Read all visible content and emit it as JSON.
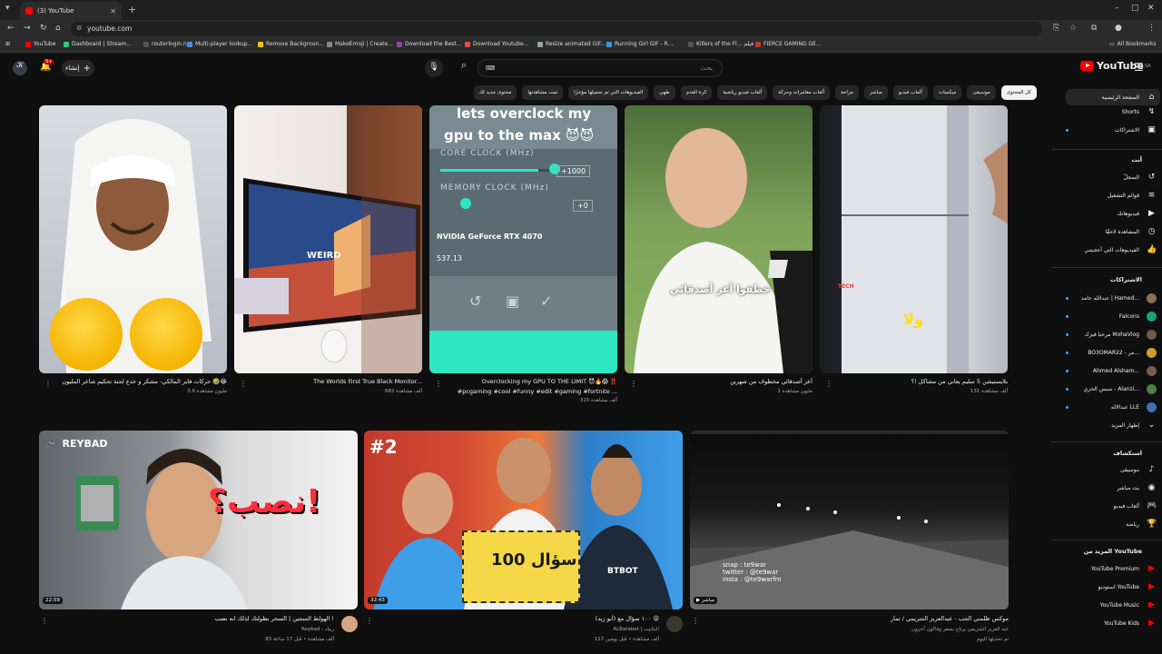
{
  "browser": {
    "tab_count": "(3)",
    "tab_title": "(3) YouTube",
    "url": "youtube.com",
    "bookmarks": [
      {
        "label": "YouTube",
        "color": "#ff0000"
      },
      {
        "label": "Dashboard | Stream...",
        "color": "#2ecc71"
      },
      {
        "label": "routerlogin.net",
        "color": "#555555"
      },
      {
        "label": "Multi-player lookup...",
        "color": "#4a90e2"
      },
      {
        "label": "Remove Backgroun...",
        "color": "#f1c40f"
      },
      {
        "label": "MakeEmoji | Create...",
        "color": "#888888"
      },
      {
        "label": "Download the Best...",
        "color": "#8e44ad"
      },
      {
        "label": "Download Youtube...",
        "color": "#e74c3c"
      },
      {
        "label": "Resize animated GIF...",
        "color": "#95a5a6"
      },
      {
        "label": "Running Girl GIF - R...",
        "color": "#3498db"
      },
      {
        "label": "Killers of the Fl... فيلم",
        "color": "#555555"
      },
      {
        "label": "FIERCE GAMING GE...",
        "color": "#c0392b"
      }
    ],
    "all_bookmarks": "All Bookmarks"
  },
  "masthead": {
    "logo_text": "YouTube",
    "logo_region": "SA",
    "search_placeholder": "بحث",
    "search_kbd": "⌨",
    "create_label": "إنشاء",
    "notif_count": "9+"
  },
  "chips": [
    {
      "label": "كل المحتوى",
      "active": true
    },
    {
      "label": "موسيقى",
      "active": false
    },
    {
      "label": "ميكسات",
      "active": false
    },
    {
      "label": "ألعاب فيديو",
      "active": false
    },
    {
      "label": "مباشر",
      "active": false
    },
    {
      "label": "مزاحة",
      "active": false
    },
    {
      "label": "ألعاب مغامرات وحركة",
      "active": false
    },
    {
      "label": "ألعاب فيديو رياضية",
      "active": false
    },
    {
      "label": "كرة القدم",
      "active": false
    },
    {
      "label": "طهي",
      "active": false
    },
    {
      "label": "الفيديوهات التي تم تحميلها مؤخرًا",
      "active": false
    },
    {
      "label": "تمت مشاهدتها",
      "active": false
    },
    {
      "label": "محتوى جديد لك",
      "active": false
    }
  ],
  "sidebar": {
    "main": [
      {
        "label": "الصفحة الرئيسية",
        "icon": "home-icon",
        "glyph": "⌂"
      },
      {
        "label": "Shorts",
        "icon": "shorts-icon",
        "glyph": "↯"
      },
      {
        "label": "الاشتراكات",
        "icon": "subscriptions-icon",
        "glyph": "▣"
      }
    ],
    "you_header": "أنت",
    "you": [
      {
        "label": "السجلّ",
        "icon": "history-icon",
        "glyph": "↺"
      },
      {
        "label": "قوائم التشغيل",
        "icon": "playlist-icon",
        "glyph": "≡"
      },
      {
        "label": "فيديوهاتك",
        "icon": "your-videos-icon",
        "glyph": "▶"
      },
      {
        "label": "المشاهدة لاحقًا",
        "icon": "watch-later-icon",
        "glyph": "◷"
      },
      {
        "label": "الفيديوهات التي أعجبتني",
        "icon": "liked-icon",
        "glyph": "👍"
      }
    ],
    "subs_header": "الاشتراكات",
    "subs": [
      {
        "label": "عبدالله حامد | Hamed...",
        "color": "#8a6f55"
      },
      {
        "label": "Falcons",
        "color": "#1aa37a"
      },
      {
        "label": "مرحبا فيزك MohaVlog",
        "color": "#6c5a48"
      },
      {
        "label": "BO3OMAR22 - مر...",
        "color": "#c9a227"
      },
      {
        "label": "Ahmed Alsham...",
        "color": "#7a5c4a"
      },
      {
        "label": "سبس الخزي - Alanzi...",
        "color": "#4f7d45"
      },
      {
        "label": "عبدالاله LLE",
        "color": "#3f6fb0"
      }
    ],
    "show_more": "إظهار المزيد",
    "explore_header": "استكشاف",
    "explore": [
      {
        "label": "موسيقى",
        "icon": "music-icon",
        "glyph": "♪"
      },
      {
        "label": "بث مباشر",
        "icon": "live-icon",
        "glyph": "◉"
      },
      {
        "label": "ألعاب فيديو",
        "icon": "gaming-icon",
        "glyph": "🎮"
      },
      {
        "label": "رياضة",
        "icon": "sports-icon",
        "glyph": "🏆"
      }
    ],
    "more_header": "المزيد من YouTube",
    "more": [
      {
        "label": "YouTube Premium"
      },
      {
        "label": "استوديو YouTube"
      },
      {
        "label": "YouTube Music"
      },
      {
        "label": "YouTube Kids"
      }
    ]
  },
  "row1": [
    {
      "title": "حركات فايز المالكي- مشكر و خدع لجنة تحكيم شاعر المليون 🤣😂",
      "views": "3.6 مليون مشاهدة"
    },
    {
      "title": "The Worlds First True Black Monitor...",
      "views": "682 ألف مشاهدة",
      "thumb_text": "WEIRD"
    },
    {
      "title": "Overclocking my GPU TO THE LIMIT 😈🔥😱 ‼️",
      "title2": "#pcgaming #cool #funny #edit #gaming #fortnite ...",
      "views": "315 ألف مشاهدة",
      "thumb_line1": "lets overclock my",
      "thumb_line2": "gpu to the max 😈😈",
      "core_clock": "CORE CLOCK (MHz)",
      "core_value": "+1000",
      "mem_clock": "MEMORY CLOCK (MHz)",
      "mem_value": "+0",
      "gpu_name": "NVIDIA GeForce RTX 4070",
      "gpu_reading": "537.13"
    },
    {
      "title": "أعز أصدقائي مخطوف من شهرين",
      "views": "1 مليون مشاهدة",
      "caption": "خطفوا أعز أصدقائي"
    },
    {
      "title": "بلايستيشن 5 سليم يعاني من مشاكل !؟",
      "views": "131 ألف مشاهدة",
      "caption": "ولا"
    }
  ],
  "row2": [
    {
      "title": "الهولط السجين | السحر بطولتك لذلك انه نصب !",
      "channel": "Reybad - ريباد",
      "views": "83 ألف مشاهدة • قبل 17 ساعة",
      "duration": "22:59",
      "brand": "REYBAD",
      "thumb_text": "نصب؟!"
    },
    {
      "title": "١٠٠ سؤال مع (أبو زيد) 😜",
      "channel": "ALBatabet | البتابيت",
      "views": "117 ألف مشاهدة • قبل يومين",
      "duration": "32:43",
      "badge": "#2",
      "board": "100 سؤال",
      "shirt": "BTBOT"
    },
    {
      "title": "موكس ظلمتي الحب - عبدالعزيز الشريمي / تمار",
      "channel": "عبد العزيز الشريمي يرتاح بسفر وفاكون آخرون",
      "views": "تم تحديثها اليوم",
      "live": "مباشر",
      "overlay": "snap : te9war\ntwitter : @te9war\ninsta : @te9warfm"
    }
  ]
}
